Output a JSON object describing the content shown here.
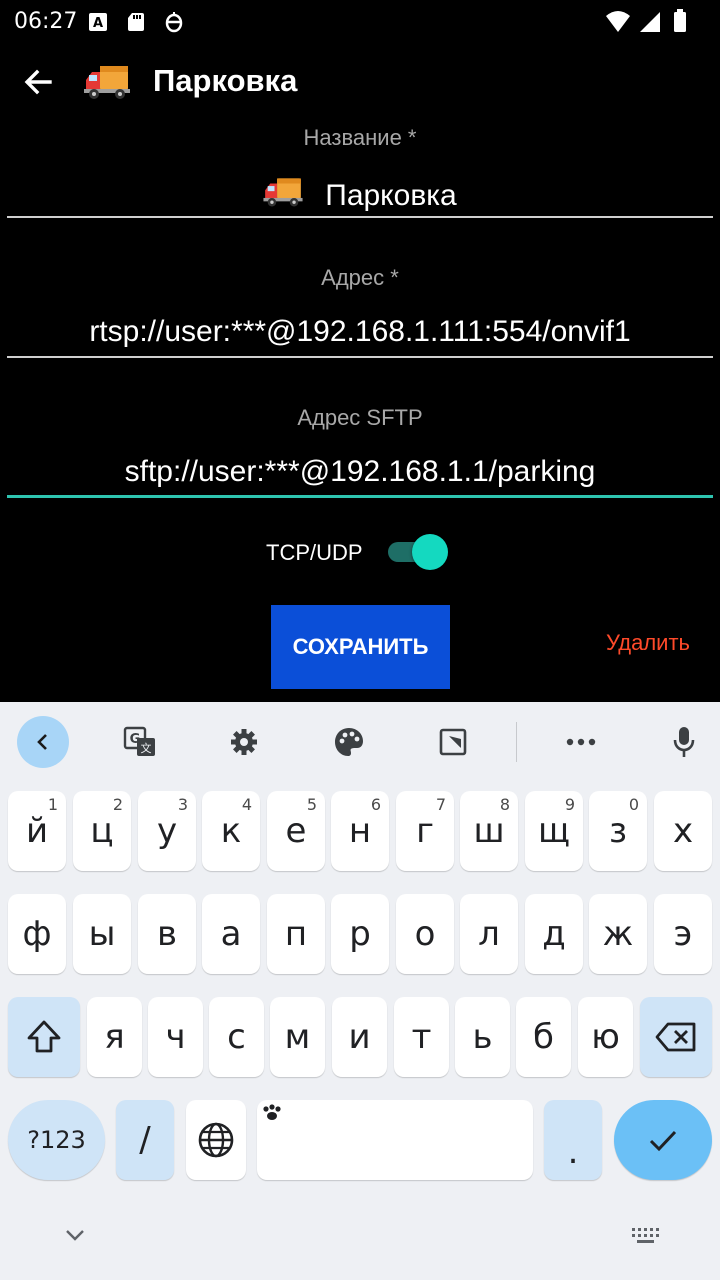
{
  "status_bar": {
    "time": "06:27"
  },
  "toolbar": {
    "title": "Парковка"
  },
  "form": {
    "name_label": "Название *",
    "name_value": "Парковка",
    "address_label": "Адрес *",
    "address_value": "rtsp://user:***@192.168.1.111:554/onvif1",
    "sftp_label": "Адрес SFTP",
    "sftp_value": "sftp://user:***@192.168.1.1/parking",
    "toggle_label": "TCP/UDP",
    "toggle_on": true,
    "save_label": "СОХРАНИТЬ",
    "delete_label": "Удалить"
  },
  "colors": {
    "accent_teal": "#14d9c0",
    "save_blue": "#0b4fd8",
    "delete_red": "#ff4a2a"
  },
  "keyboard": {
    "row1": [
      "й",
      "ц",
      "у",
      "к",
      "е",
      "н",
      "г",
      "ш",
      "щ",
      "з",
      "х"
    ],
    "row1_hints": [
      "1",
      "2",
      "3",
      "4",
      "5",
      "6",
      "7",
      "8",
      "9",
      "0",
      ""
    ],
    "row2": [
      "ф",
      "ы",
      "в",
      "а",
      "п",
      "р",
      "о",
      "л",
      "д",
      "ж",
      "э"
    ],
    "row3": [
      "я",
      "ч",
      "с",
      "м",
      "и",
      "т",
      "ь",
      "б",
      "ю"
    ],
    "symbols_label": "?123",
    "slash_label": "/",
    "period_label": "."
  }
}
